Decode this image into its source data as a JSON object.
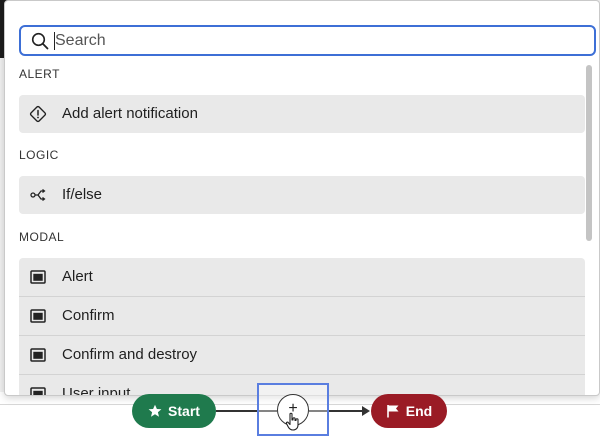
{
  "search": {
    "placeholder": "Search",
    "value": ""
  },
  "sections": {
    "alert": {
      "label": "ALERT",
      "items": [
        {
          "label": "Add alert notification",
          "icon": "alert-diamond-icon"
        }
      ]
    },
    "logic": {
      "label": "LOGIC",
      "items": [
        {
          "label": "If/else",
          "icon": "branch-icon"
        }
      ]
    },
    "modal": {
      "label": "MODAL",
      "items": [
        {
          "label": "Alert",
          "icon": "modal-window-icon"
        },
        {
          "label": "Confirm",
          "icon": "modal-window-icon"
        },
        {
          "label": "Confirm and destroy",
          "icon": "modal-window-icon"
        },
        {
          "label": "User input",
          "icon": "modal-window-icon"
        }
      ]
    }
  },
  "flow": {
    "start_label": "Start",
    "end_label": "End",
    "add_symbol": "+"
  },
  "colors": {
    "accent": "#3d6fd6",
    "start": "#1f7a4d",
    "end": "#9a1b25",
    "item_bg": "#e9e9e9"
  }
}
